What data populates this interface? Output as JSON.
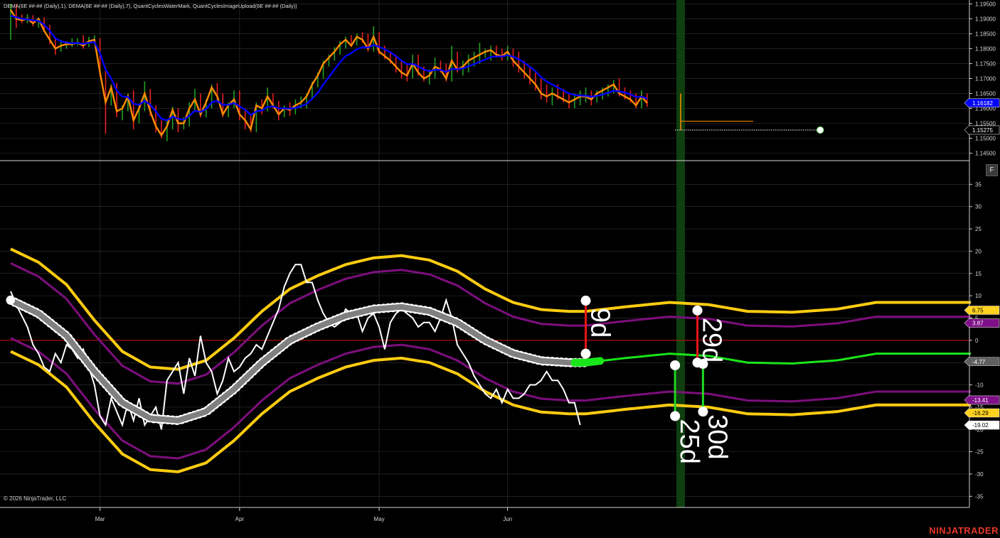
{
  "header": {
    "indicators": "DEMA(6E ##-## (Daily),1), DEMA(6E ##-## (Daily),7), QuantCyclesWaterMark, QuantCyclesImageUpload(6E ##-## (Daily))"
  },
  "price_panel": {
    "ylim": [
      1.1425,
      1.1963
    ],
    "ticks": [
      "1.19500",
      "1.19000",
      "1.18500",
      "1.18000",
      "1.17500",
      "1.17000",
      "1.16500",
      "1.16000",
      "1.15500",
      "1.15000",
      "1.14500"
    ],
    "current_price_tag": {
      "text": "1.16182",
      "value": 1.16182,
      "color": "#0000ff"
    },
    "target_price_tag": {
      "text": "1.15275",
      "value": 1.15275,
      "color": "#000000"
    }
  },
  "oscillator_panel": {
    "ylim": [
      -37.5,
      40
    ],
    "ticks": [
      "35",
      "30",
      "25",
      "20",
      "15",
      "10",
      "5",
      "0",
      "-5",
      "-10",
      "-15",
      "-20",
      "-25",
      "-30",
      "-35"
    ],
    "tags": [
      {
        "text": "6.75",
        "value": 6.75,
        "color": "#ffd21f",
        "text_color": "#000000"
      },
      {
        "text": "3.87",
        "value": 3.87,
        "color": "#80108a",
        "text_color": "#ffffff"
      },
      {
        "text": "-4.77",
        "value": -4.77,
        "color": "#606060",
        "text_color": "#ffffff"
      },
      {
        "text": "-13.41",
        "value": -13.41,
        "color": "#80108a",
        "text_color": "#ffffff"
      },
      {
        "text": "-16.29",
        "value": -16.29,
        "color": "#ffd21f",
        "text_color": "#000000"
      },
      {
        "text": "-19.02",
        "value": -19.02,
        "color": "#ffffff",
        "text_color": "#000000"
      }
    ],
    "cycle_markers": [
      {
        "label": "9d",
        "x_day": 103,
        "y_top": 8.9,
        "y_bottom": -3.0,
        "color": "#e81515"
      },
      {
        "label": "29d",
        "x_day": 123,
        "y_top": 6.7,
        "y_bottom": -5.0,
        "color": "#e81515"
      },
      {
        "label": "25d",
        "x_day": 119,
        "y_top": -5.6,
        "y_bottom": -17.0,
        "color": "#22d822"
      },
      {
        "label": "30d",
        "x_day": 124,
        "y_top": -5.3,
        "y_bottom": -16.0,
        "color": "#22d822"
      }
    ]
  },
  "x_axis": {
    "ticks": [
      {
        "label": "Mar",
        "day": 16
      },
      {
        "label": "Apr",
        "day": 41
      },
      {
        "label": "May",
        "day": 66
      },
      {
        "label": "Jun",
        "day": 89
      }
    ]
  },
  "colors": {
    "fast_dema": "#ff8c00",
    "slow_dema": "#0000ff",
    "bar_up": "#22a022",
    "bar_down": "#e82020",
    "outer_band": "#ffcc11",
    "inner_band": "#7d0e7d",
    "cycle_line": "#808080",
    "projection": "#19e619",
    "oscillator": "#ffffff",
    "zero_line": "#d01010",
    "now_band": "#0f3e0f"
  },
  "copyright": "© 2026 NinjaTrader, LLC",
  "brand": "NINJATRADER",
  "f_button": "F",
  "chart_data": {
    "type": "line",
    "x_unit": "trading-day index",
    "price_bars": [
      [
        1.191,
        1.195,
        1.183,
        1.193
      ],
      [
        1.194,
        1.195,
        1.187,
        1.19
      ],
      [
        1.1905,
        1.1915,
        1.1885,
        1.1895
      ],
      [
        1.1895,
        1.1915,
        1.1885,
        1.19
      ],
      [
        1.19,
        1.1912,
        1.1875,
        1.1885
      ],
      [
        1.1885,
        1.1905,
        1.187,
        1.19
      ],
      [
        1.1895,
        1.1905,
        1.1855,
        1.186
      ],
      [
        1.186,
        1.188,
        1.1815,
        1.183
      ],
      [
        1.183,
        1.184,
        1.178,
        1.18
      ],
      [
        1.18,
        1.183,
        1.179,
        1.181
      ],
      [
        1.181,
        1.1825,
        1.18,
        1.1815
      ],
      [
        1.181,
        1.1835,
        1.1805,
        1.1815
      ],
      [
        1.1815,
        1.1835,
        1.181,
        1.182
      ],
      [
        1.182,
        1.1845,
        1.18,
        1.181
      ],
      [
        1.181,
        1.184,
        1.1805,
        1.1825
      ],
      [
        1.1825,
        1.1845,
        1.1815,
        1.183
      ],
      [
        1.1825,
        1.1835,
        1.1705,
        1.172
      ],
      [
        1.172,
        1.174,
        1.1515,
        1.162
      ],
      [
        1.162,
        1.168,
        1.161,
        1.167
      ],
      [
        1.167,
        1.1685,
        1.157,
        1.159
      ],
      [
        1.159,
        1.161,
        1.156,
        1.16
      ],
      [
        1.16,
        1.165,
        1.159,
        1.164
      ],
      [
        1.164,
        1.166,
        1.153,
        1.156
      ],
      [
        1.156,
        1.1615,
        1.155,
        1.16
      ],
      [
        1.16,
        1.169,
        1.159,
        1.165
      ],
      [
        1.165,
        1.1665,
        1.1575,
        1.159
      ],
      [
        1.159,
        1.161,
        1.152,
        1.154
      ],
      [
        1.154,
        1.156,
        1.15,
        1.151
      ],
      [
        1.151,
        1.156,
        1.149,
        1.154
      ],
      [
        1.154,
        1.1605,
        1.153,
        1.1595
      ],
      [
        1.159,
        1.16,
        1.152,
        1.155
      ],
      [
        1.155,
        1.157,
        1.153,
        1.155
      ],
      [
        1.155,
        1.162,
        1.154,
        1.16
      ],
      [
        1.16,
        1.1665,
        1.159,
        1.163
      ],
      [
        1.163,
        1.165,
        1.157,
        1.158
      ],
      [
        1.158,
        1.163,
        1.157,
        1.162
      ],
      [
        1.162,
        1.168,
        1.16,
        1.167
      ],
      [
        1.167,
        1.1685,
        1.162,
        1.164
      ],
      [
        1.164,
        1.165,
        1.157,
        1.158
      ],
      [
        1.158,
        1.162,
        1.157,
        1.161
      ],
      [
        1.161,
        1.166,
        1.16,
        1.163
      ],
      [
        1.163,
        1.166,
        1.156,
        1.158
      ],
      [
        1.158,
        1.16,
        1.153,
        1.156
      ],
      [
        1.156,
        1.158,
        1.152,
        1.153
      ],
      [
        1.153,
        1.162,
        1.152,
        1.161
      ],
      [
        1.161,
        1.163,
        1.158,
        1.16
      ],
      [
        1.16,
        1.167,
        1.159,
        1.164
      ],
      [
        1.164,
        1.165,
        1.16,
        1.161
      ],
      [
        1.161,
        1.1625,
        1.156,
        1.158
      ],
      [
        1.158,
        1.161,
        1.157,
        1.16
      ],
      [
        1.16,
        1.162,
        1.1575,
        1.1595
      ],
      [
        1.1595,
        1.163,
        1.158,
        1.161
      ],
      [
        1.161,
        1.164,
        1.16,
        1.162
      ],
      [
        1.162,
        1.165,
        1.16,
        1.164
      ],
      [
        1.164,
        1.169,
        1.163,
        1.168
      ],
      [
        1.168,
        1.172,
        1.167,
        1.171
      ],
      [
        1.171,
        1.176,
        1.17,
        1.175
      ],
      [
        1.175,
        1.178,
        1.174,
        1.177
      ],
      [
        1.177,
        1.1805,
        1.176,
        1.179
      ],
      [
        1.179,
        1.1825,
        1.178,
        1.1815
      ],
      [
        1.1815,
        1.184,
        1.18,
        1.183
      ],
      [
        1.183,
        1.1845,
        1.1805,
        1.181
      ],
      [
        1.1815,
        1.185,
        1.181,
        1.184
      ],
      [
        1.184,
        1.1855,
        1.182,
        1.183
      ],
      [
        1.183,
        1.185,
        1.179,
        1.18
      ],
      [
        1.18,
        1.1875,
        1.179,
        1.184
      ],
      [
        1.184,
        1.1855,
        1.178,
        1.179
      ],
      [
        1.179,
        1.181,
        1.1765,
        1.1775
      ],
      [
        1.1775,
        1.179,
        1.175,
        1.176
      ],
      [
        1.176,
        1.178,
        1.172,
        1.174
      ],
      [
        1.174,
        1.176,
        1.17,
        1.172
      ],
      [
        1.172,
        1.1745,
        1.169,
        1.171
      ],
      [
        1.171,
        1.178,
        1.17,
        1.175
      ],
      [
        1.175,
        1.178,
        1.171,
        1.172
      ],
      [
        1.172,
        1.174,
        1.169,
        1.17
      ],
      [
        1.17,
        1.173,
        1.168,
        1.171
      ],
      [
        1.171,
        1.177,
        1.17,
        1.174
      ],
      [
        1.174,
        1.176,
        1.172,
        1.173
      ],
      [
        1.173,
        1.175,
        1.169,
        1.17
      ],
      [
        1.17,
        1.181,
        1.169,
        1.176
      ],
      [
        1.176,
        1.179,
        1.172,
        1.173
      ],
      [
        1.173,
        1.176,
        1.171,
        1.174
      ],
      [
        1.174,
        1.178,
        1.172,
        1.176
      ],
      [
        1.176,
        1.179,
        1.174,
        1.177
      ],
      [
        1.177,
        1.182,
        1.175,
        1.178
      ],
      [
        1.178,
        1.18,
        1.177,
        1.179
      ],
      [
        1.179,
        1.181,
        1.176,
        1.1795
      ],
      [
        1.1795,
        1.181,
        1.177,
        1.178
      ],
      [
        1.178,
        1.18,
        1.176,
        1.1775
      ],
      [
        1.1775,
        1.181,
        1.176,
        1.179
      ],
      [
        1.179,
        1.18,
        1.174,
        1.176
      ],
      [
        1.176,
        1.179,
        1.172,
        1.174
      ],
      [
        1.174,
        1.176,
        1.17,
        1.172
      ],
      [
        1.172,
        1.174,
        1.168,
        1.17
      ],
      [
        1.17,
        1.172,
        1.166,
        1.168
      ],
      [
        1.168,
        1.17,
        1.163,
        1.165
      ],
      [
        1.165,
        1.168,
        1.162,
        1.164
      ],
      [
        1.164,
        1.167,
        1.161,
        1.165
      ],
      [
        1.165,
        1.168,
        1.163,
        1.164
      ],
      [
        1.164,
        1.1665,
        1.162,
        1.163
      ],
      [
        1.163,
        1.165,
        1.16,
        1.162
      ],
      [
        1.162,
        1.165,
        1.16,
        1.163
      ],
      [
        1.163,
        1.166,
        1.161,
        1.164
      ],
      [
        1.164,
        1.167,
        1.162,
        1.164
      ],
      [
        1.164,
        1.166,
        1.161,
        1.163
      ],
      [
        1.163,
        1.166,
        1.162,
        1.165
      ],
      [
        1.165,
        1.167,
        1.163,
        1.166
      ],
      [
        1.166,
        1.168,
        1.164,
        1.167
      ],
      [
        1.167,
        1.1695,
        1.165,
        1.168
      ],
      [
        1.168,
        1.17,
        1.164,
        1.165
      ],
      [
        1.165,
        1.167,
        1.163,
        1.164
      ],
      [
        1.164,
        1.166,
        1.162,
        1.163
      ],
      [
        1.163,
        1.165,
        1.16,
        1.161
      ],
      [
        1.161,
        1.166,
        1.16,
        1.164
      ],
      [
        1.164,
        1.165,
        1.1605,
        1.1618
      ]
    ],
    "dema_fast": [
      1.193,
      1.19,
      1.1895,
      1.19,
      1.1885,
      1.19,
      1.186,
      1.183,
      1.18,
      1.181,
      1.1815,
      1.1815,
      1.182,
      1.181,
      1.1825,
      1.183,
      1.172,
      1.162,
      1.167,
      1.159,
      1.16,
      1.164,
      1.156,
      1.16,
      1.165,
      1.159,
      1.154,
      1.151,
      1.154,
      1.1595,
      1.155,
      1.155,
      1.16,
      1.163,
      1.158,
      1.162,
      1.167,
      1.164,
      1.158,
      1.161,
      1.163,
      1.158,
      1.156,
      1.153,
      1.161,
      1.16,
      1.164,
      1.161,
      1.158,
      1.16,
      1.1595,
      1.161,
      1.162,
      1.164,
      1.168,
      1.171,
      1.175,
      1.177,
      1.179,
      1.1815,
      1.183,
      1.181,
      1.184,
      1.183,
      1.18,
      1.184,
      1.179,
      1.1775,
      1.176,
      1.174,
      1.172,
      1.171,
      1.175,
      1.172,
      1.17,
      1.171,
      1.174,
      1.173,
      1.17,
      1.176,
      1.173,
      1.174,
      1.176,
      1.177,
      1.178,
      1.179,
      1.1795,
      1.178,
      1.1775,
      1.179,
      1.176,
      1.174,
      1.172,
      1.17,
      1.168,
      1.165,
      1.164,
      1.165,
      1.164,
      1.163,
      1.162,
      1.163,
      1.164,
      1.164,
      1.163,
      1.165,
      1.166,
      1.167,
      1.168,
      1.165,
      1.164,
      1.163,
      1.161,
      1.164,
      1.1618
    ],
    "dema_slow": [
      1.191,
      1.1905,
      1.19,
      1.1898,
      1.1895,
      1.1893,
      1.188,
      1.186,
      1.1835,
      1.1825,
      1.182,
      1.1818,
      1.1819,
      1.1816,
      1.182,
      1.1822,
      1.1785,
      1.173,
      1.17,
      1.166,
      1.164,
      1.1638,
      1.1615,
      1.1612,
      1.1625,
      1.1612,
      1.159,
      1.1565,
      1.156,
      1.1572,
      1.1565,
      1.1562,
      1.1575,
      1.1592,
      1.1588,
      1.1598,
      1.162,
      1.1625,
      1.1612,
      1.1612,
      1.1618,
      1.1607,
      1.1595,
      1.1578,
      1.159,
      1.1593,
      1.1605,
      1.1607,
      1.16,
      1.16,
      1.1599,
      1.1602,
      1.1607,
      1.1615,
      1.1632,
      1.1652,
      1.168,
      1.1705,
      1.173,
      1.1755,
      1.1775,
      1.1785,
      1.1798,
      1.1805,
      1.1804,
      1.1812,
      1.1806,
      1.1798,
      1.1788,
      1.1775,
      1.176,
      1.1748,
      1.1749,
      1.1741,
      1.173,
      1.1725,
      1.1729,
      1.1729,
      1.1722,
      1.1732,
      1.1731,
      1.1734,
      1.1741,
      1.1748,
      1.1756,
      1.1764,
      1.1772,
      1.1774,
      1.1774,
      1.1778,
      1.1773,
      1.1765,
      1.1753,
      1.1739,
      1.1724,
      1.1705,
      1.169,
      1.168,
      1.167,
      1.166,
      1.165,
      1.1645,
      1.1643,
      1.1642,
      1.1639,
      1.1642,
      1.1646,
      1.1652,
      1.1659,
      1.1657,
      1.1653,
      1.1647,
      1.1638,
      1.1639,
      1.1632
    ],
    "target_line": {
      "from_day": 119,
      "to_day": 145,
      "value": 1.15275
    },
    "orange_marker": {
      "from_day": 120,
      "to_day": 133,
      "value": 1.1557,
      "vertical_from": 1.165
    },
    "oscillator": [
      11,
      8,
      5.5,
      3,
      -1,
      -3,
      -6,
      -7,
      -3,
      -5,
      -1,
      -2,
      -4,
      -2,
      -6,
      -10,
      -17,
      -19,
      -13,
      -16,
      -19,
      -14,
      -18,
      -13,
      -19,
      -17,
      -15,
      -20,
      -9,
      -7,
      -5,
      -12,
      -4,
      -8,
      1,
      -5,
      -7,
      -12,
      -9,
      -4,
      -7,
      -6,
      -4,
      -3,
      -1,
      -2,
      1,
      4,
      7,
      12,
      15,
      17,
      17,
      13,
      13,
      9,
      6,
      4,
      3,
      4,
      7,
      6,
      6,
      2,
      5,
      6,
      3,
      -2,
      4,
      6,
      7,
      6,
      5,
      3,
      4,
      4,
      2,
      5,
      9,
      5,
      -1,
      -3,
      -5,
      -8,
      -10,
      -12,
      -13,
      -11,
      -14,
      -11,
      -13,
      -13,
      -12,
      -10,
      -10,
      -9,
      -7,
      -9,
      -9,
      -11,
      -14,
      -14,
      -19
    ],
    "oscillator_start_day": 0,
    "cycle_curve": {
      "center": -18,
      "amplitude": 24,
      "period": 2.2,
      "note_range": [
        0,
        118
      ]
    },
    "projection_range": [
      115,
      170
    ],
    "now_day": 120
  }
}
